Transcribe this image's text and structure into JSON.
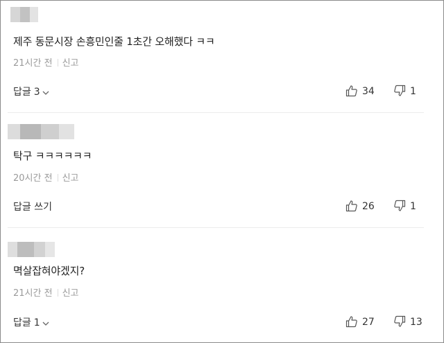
{
  "comments": [
    {
      "text": "제주 동문시장 손흥민인줄 1초간 오해했다 ㅋㅋ",
      "time": "21시간 전",
      "report": "신고",
      "reply_label": "답글",
      "reply_count": "3",
      "likes": "34",
      "dislikes": "1"
    },
    {
      "text": "탁구 ㅋㅋㅋㅋㅋㅋ",
      "time": "20시간 전",
      "report": "신고",
      "reply_label": "답글 쓰기",
      "likes": "26",
      "dislikes": "1"
    },
    {
      "text": "멱살잡혀야겠지?",
      "time": "21시간 전",
      "report": "신고",
      "reply_label": "답글",
      "reply_count": "1",
      "likes": "27",
      "dislikes": "13"
    }
  ],
  "icons": {
    "like": "thumbs-up-icon",
    "dislike": "thumbs-down-icon",
    "expand": "chevron-down-icon"
  },
  "colors": {
    "text": "#222222",
    "meta": "#9a9a9a",
    "divider": "#ececec",
    "border": "#8a8a8a"
  }
}
